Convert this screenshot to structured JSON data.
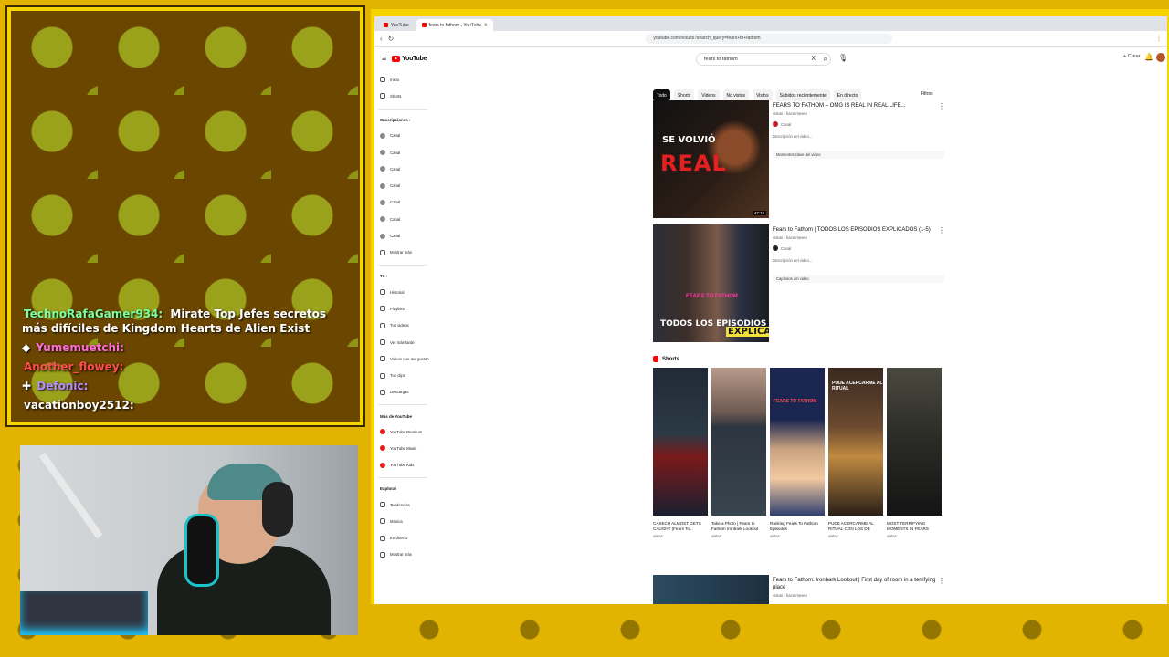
{
  "chat": {
    "messages": [
      {
        "user": "TechnoRafaGamer934:",
        "user_color": "#7dff9e",
        "text": "Mirate Top Jefes secretos más difíciles de Kingdom Hearts de Alien Exist",
        "badge": ""
      },
      {
        "user": "Yumemuetchi:",
        "user_color": "#ff6ad5",
        "text": "",
        "badge": "◆"
      },
      {
        "user": "Another_flowey:",
        "user_color": "#ff4d4d",
        "text": "",
        "badge": ""
      },
      {
        "user": "Defonic:",
        "user_color": "#b98cff",
        "text": "",
        "badge": "✚"
      },
      {
        "user": "vacationboy2512:",
        "user_color": "#ffffff",
        "text": "",
        "badge": ""
      }
    ]
  },
  "browser": {
    "tabs": [
      {
        "label": "YouTube",
        "active": false
      },
      {
        "label": "fears to fathom - YouTube",
        "active": true
      }
    ],
    "url": "youtube.com/results?search_query=fears+to+fathom",
    "nav_back": "‹",
    "nav_reload": "↻",
    "toolbar_right": "⋮"
  },
  "youtube": {
    "logo_text": "YouTube",
    "search_query": "fears to fathom",
    "search_clear": "X",
    "search_icon": "⌕",
    "mic_icon": "🎙",
    "create_label": "+ Crear",
    "bell_icon": "🔔",
    "menu_icon": "≡",
    "sidebar": {
      "top": [
        "Inicio",
        "Shorts"
      ],
      "subs_heading": "Suscripciones ›",
      "subs": [
        "Canal",
        "Canal",
        "Canal",
        "Canal",
        "Canal",
        "Canal",
        "Canal"
      ],
      "show_more": "Mostrar más",
      "you_heading": "Tú ›",
      "you": [
        "Historial",
        "Playlists",
        "Tus videos",
        "Ver más tarde",
        "Videos que me gustan",
        "Tus clips",
        "Descargas"
      ],
      "more_heading": "Más de YouTube",
      "more": [
        "YouTube Premium",
        "YouTube Music",
        "YouTube Kids"
      ],
      "explore_heading": "Explorar",
      "explore": [
        "Tendencias",
        "Música",
        "En directo",
        "Mostrar más"
      ]
    },
    "chips": [
      "Todo",
      "Shorts",
      "Videos",
      "No vistos",
      "Vistos",
      "Subidos recientemente",
      "En directo"
    ],
    "filters_label": "Filtros",
    "results": [
      {
        "title": "FEARS TO FATHOM – OMG IS REAL IN REAL LIFE...",
        "meta": "vistas · hace meses",
        "channel": "Canal",
        "desc": "Descripción del video...",
        "extra": "Momentos clave del video",
        "thumb_line1": "SE VOLVIÓ",
        "thumb_line2": "REAL",
        "duration": "47:18"
      },
      {
        "title": "Fears to Fathom | TODOS LOS EPISODIOS EXPLICADOS (1-5)",
        "meta": "vistas · hace meses",
        "channel": "Canal",
        "desc": "Descripción del video...",
        "extra": "Capítulos del video",
        "thumb_line1": "FEARS TO FATHOM",
        "thumb_line2": "TODOS LOS EPISODIOS",
        "thumb_line3": "EXPLICADOS",
        "duration": ""
      }
    ],
    "shorts_heading": "Shorts",
    "shorts": [
      {
        "title": "CASECH ALMOST GETS CAUGHT (Fears To...",
        "views": "vistas",
        "label": ""
      },
      {
        "title": "Take a Photo | Fears to Fathom Ironbark Lookout",
        "views": "vistas",
        "label": ""
      },
      {
        "title": "Ranking Fears To Fathom Episodes",
        "views": "vistas",
        "label": "FEARS TO FATHOM"
      },
      {
        "title": "PUDE ACERCARME AL RITUAL CON LOS DE LA...",
        "views": "vistas",
        "label": "PUDE ACERCARME AL RITUAL"
      },
      {
        "title": "MOST TERRIFYING MOMENTS IN FEARS TO...",
        "views": "vistas",
        "label": ""
      }
    ],
    "last_result": {
      "title": "Fears to Fathom: Ironbark Lookout | First day of room in a terrifying place",
      "meta": "vistas · hace meses"
    }
  }
}
